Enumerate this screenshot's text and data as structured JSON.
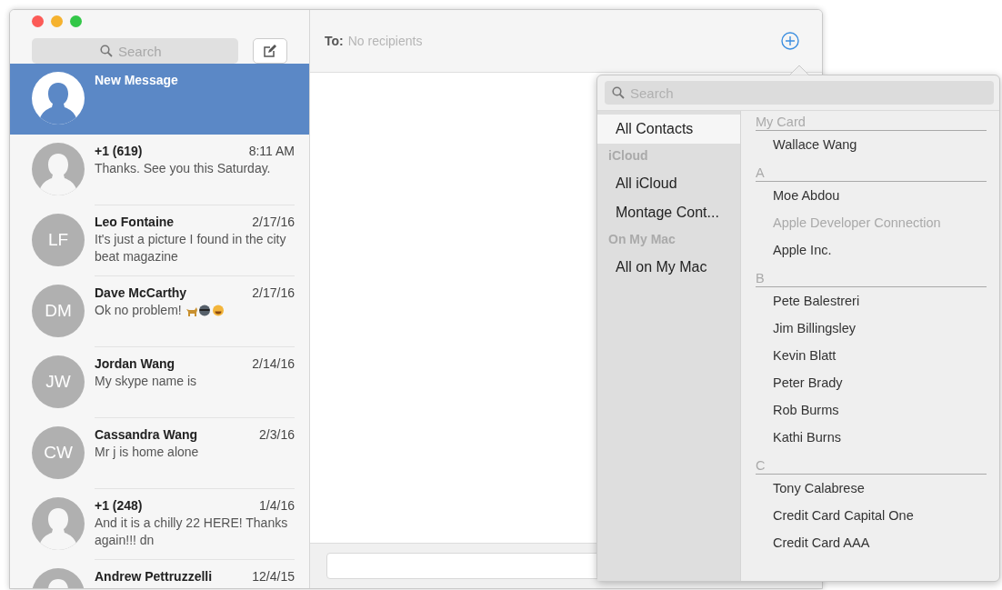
{
  "sidebar": {
    "search": {
      "placeholder": "Search"
    },
    "conversations": [
      {
        "name": "New Message",
        "avatar": {
          "kind": "silhouette"
        },
        "selected": true
      },
      {
        "name": "+1 (619)",
        "date": "8:11 AM",
        "preview": "Thanks. See you this Saturday.",
        "avatar": {
          "kind": "silhouette"
        },
        "selected": false
      },
      {
        "name": "Leo Fontaine",
        "date": "2/17/16",
        "preview": "It's just a picture I found in the city beat magazine",
        "avatar": {
          "kind": "initials",
          "initials": "LF"
        },
        "selected": false
      },
      {
        "name": "Dave McCarthy",
        "date": "2/17/16",
        "preview": "Ok no problem!",
        "has_emoji": true,
        "avatar": {
          "kind": "initials",
          "initials": "DM"
        },
        "selected": false
      },
      {
        "name": "Jordan Wang",
        "date": "2/14/16",
        "preview": "My skype name is",
        "avatar": {
          "kind": "initials",
          "initials": "JW"
        },
        "selected": false
      },
      {
        "name": "Cassandra Wang",
        "date": "2/3/16",
        "preview": "Mr j is home alone",
        "avatar": {
          "kind": "initials",
          "initials": "CW"
        },
        "selected": false
      },
      {
        "name": "+1 (248)",
        "date": "1/4/16",
        "preview": "And it is a chilly 22 HERE! Thanks again!!! dn",
        "avatar": {
          "kind": "silhouette"
        },
        "selected": false
      },
      {
        "name": "Andrew Pettruzzelli",
        "date": "12/4/15",
        "avatar": {
          "kind": "silhouette"
        },
        "selected": false
      }
    ]
  },
  "compose": {
    "to_label": "To:",
    "to_placeholder": "No recipients"
  },
  "contacts_popover": {
    "search": {
      "placeholder": "Search"
    },
    "groups": [
      {
        "kind": "item",
        "label": "All Contacts",
        "selected": true
      },
      {
        "kind": "header",
        "label": "iCloud"
      },
      {
        "kind": "item",
        "label": "All iCloud",
        "selected": false
      },
      {
        "kind": "item",
        "label": "Montage Cont...",
        "selected": false
      },
      {
        "kind": "header",
        "label": "On My Mac"
      },
      {
        "kind": "item",
        "label": "All on My Mac",
        "selected": false
      }
    ],
    "sections": [
      {
        "header": "My Card",
        "contacts": [
          {
            "name": "Wallace Wang",
            "disabled": false
          }
        ]
      },
      {
        "header": "A",
        "contacts": [
          {
            "name": "Moe Abdou",
            "disabled": false
          },
          {
            "name": "Apple Developer Connection",
            "disabled": true
          },
          {
            "name": "Apple Inc.",
            "disabled": false
          }
        ]
      },
      {
        "header": "B",
        "contacts": [
          {
            "name": "Pete Balestreri",
            "disabled": false
          },
          {
            "name": "Jim Billingsley",
            "disabled": false
          },
          {
            "name": "Kevin Blatt",
            "disabled": false
          },
          {
            "name": "Peter Brady",
            "disabled": false
          },
          {
            "name": "Rob Burms",
            "disabled": false
          },
          {
            "name": "Kathi Burns",
            "disabled": false
          }
        ]
      },
      {
        "header": "C",
        "contacts": [
          {
            "name": "Tony Calabrese",
            "disabled": false
          },
          {
            "name": "Credit Card Capital One",
            "disabled": false
          },
          {
            "name": "Credit Card AAA",
            "disabled": false
          }
        ]
      }
    ]
  }
}
